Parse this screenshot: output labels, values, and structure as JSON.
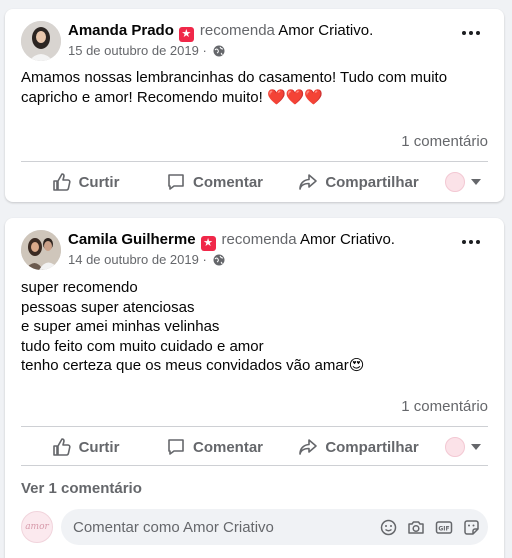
{
  "posts": [
    {
      "author": "Amanda Prado",
      "verb": "recomenda",
      "page": "Amor Criativo",
      "date": "15 de outubro de 2019 ·",
      "text_lines": [
        "Amamos nossas lembrancinhas do casamento! Tudo com muito",
        "capricho e amor! Recomendo muito! ❤️❤️❤️"
      ],
      "comment_count": "1 comentário"
    },
    {
      "author": "Camila Guilherme",
      "verb": "recomenda",
      "page": "Amor Criativo",
      "date": "14 de outubro de 2019 ·",
      "text_lines": [
        "super recomendo",
        "pessoas super atenciosas",
        "e super amei minhas velinhas",
        "tudo feito com muito cuidado  e amor",
        "tenho certeza que os meus convidados vão amar😍"
      ],
      "comment_count": "1 comentário"
    }
  ],
  "actions": {
    "like": "Curtir",
    "comment": "Comentar",
    "share": "Compartilhar"
  },
  "view_comments": "Ver 1 comentário",
  "comment_box": {
    "placeholder": "Comentar como Amor Criativo",
    "avatar_text": "amor"
  },
  "colors": {
    "recommend_badge": "#f02849",
    "secondary_text": "#65676b",
    "background": "#f0f2f5"
  },
  "icons": {
    "recommend": "star-badge-icon",
    "audience": "globe-icon",
    "like": "thumbs-up-icon",
    "comment": "speech-bubble-icon",
    "share": "share-arrow-icon",
    "emoji": "smiley-icon",
    "camera": "camera-icon",
    "gif": "gif-icon",
    "sticker": "sticker-icon"
  }
}
